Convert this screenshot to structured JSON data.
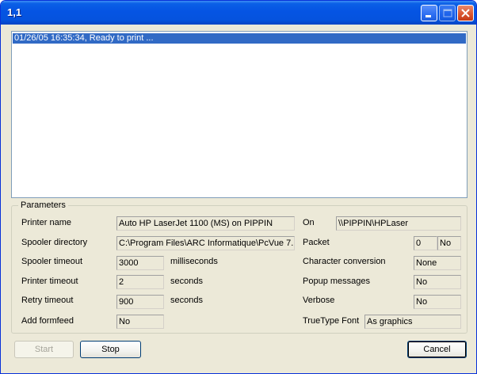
{
  "window": {
    "title": "1,1"
  },
  "log": {
    "entries": [
      "01/26/05 16:35:34, Ready to print ..."
    ]
  },
  "parameters": {
    "legend": "Parameters",
    "printer_name": {
      "label": "Printer name",
      "value": "Auto HP LaserJet 1100 (MS) on PIPPIN"
    },
    "on": {
      "label": "On",
      "value": "\\\\PIPPIN\\HPLaser"
    },
    "spooler_directory": {
      "label": "Spooler directory",
      "value": "C:\\Program Files\\ARC Informatique\\PcVue 7."
    },
    "packet": {
      "label": "Packet",
      "value": "0",
      "flag": "No"
    },
    "spooler_timeout": {
      "label": "Spooler timeout",
      "value": "3000",
      "unit": "milliseconds"
    },
    "character_conversion": {
      "label": "Character conversion",
      "value": "None"
    },
    "printer_timeout": {
      "label": "Printer timeout",
      "value": "2",
      "unit": "seconds"
    },
    "popup_messages": {
      "label": "Popup messages",
      "value": "No"
    },
    "retry_timeout": {
      "label": "Retry timeout",
      "value": "900",
      "unit": "seconds"
    },
    "verbose": {
      "label": "Verbose",
      "value": "No"
    },
    "add_formfeed": {
      "label": "Add formfeed",
      "value": "No"
    },
    "truetype_font": {
      "label": "TrueType Font",
      "value": "As graphics"
    }
  },
  "buttons": {
    "start": "Start",
    "stop": "Stop",
    "cancel": "Cancel"
  }
}
